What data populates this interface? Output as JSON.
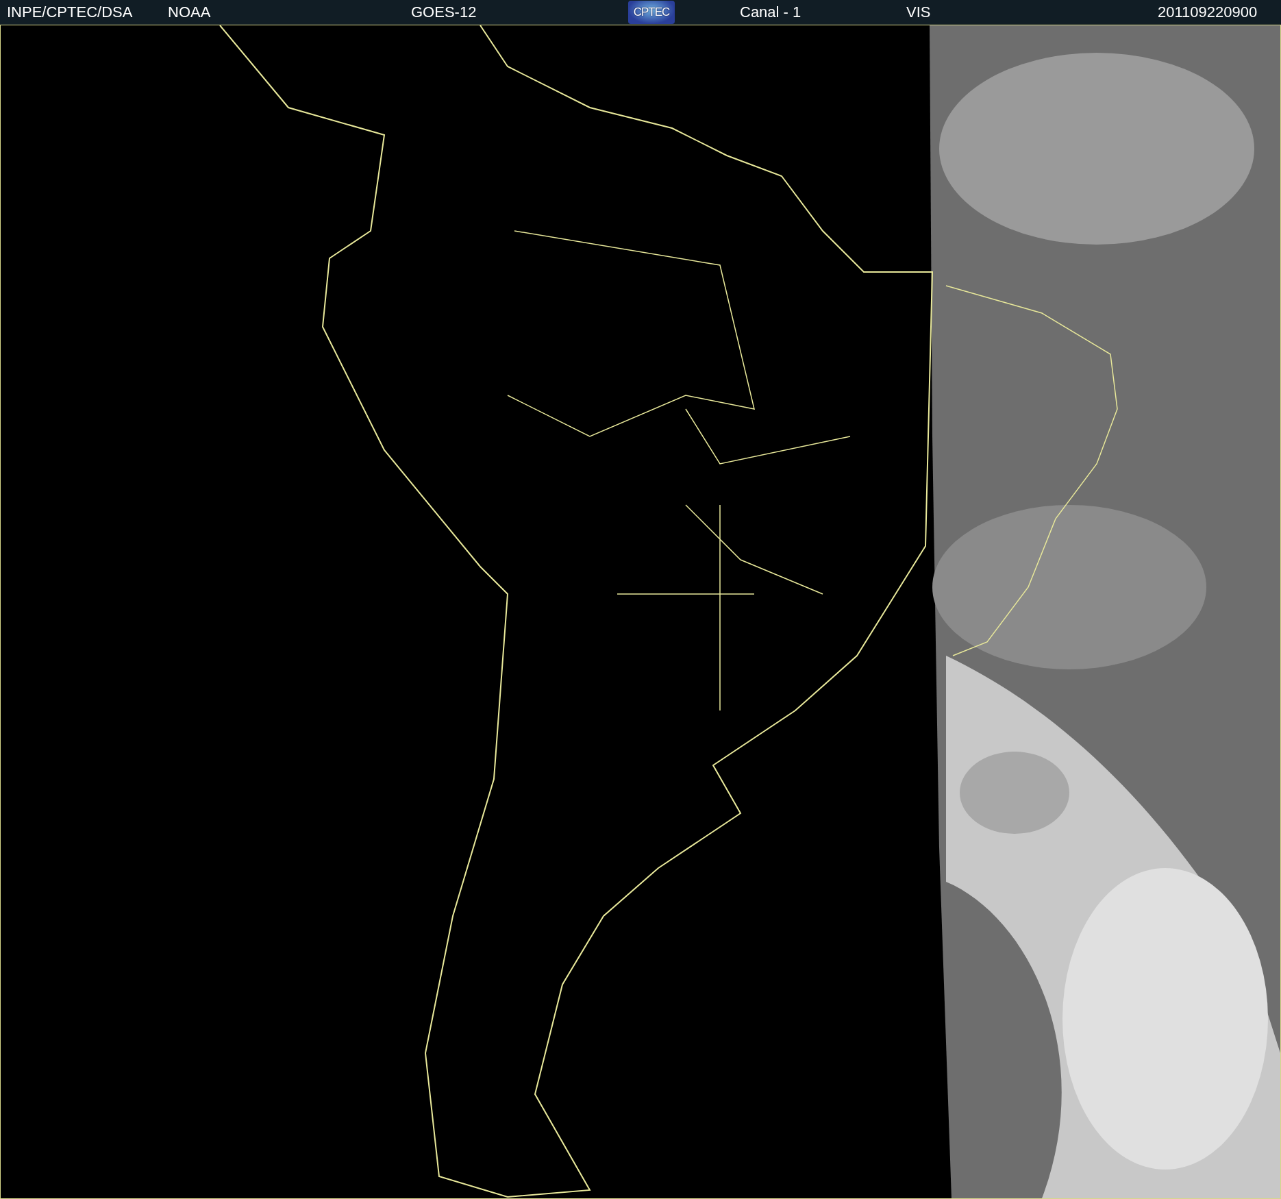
{
  "header": {
    "agency": "INPE/CPTEC/DSA",
    "source": "NOAA",
    "satellite": "GOES-12",
    "logo": "CPTEC",
    "channel": "Canal - 1",
    "band": "VIS",
    "timestamp": "201109220900"
  }
}
